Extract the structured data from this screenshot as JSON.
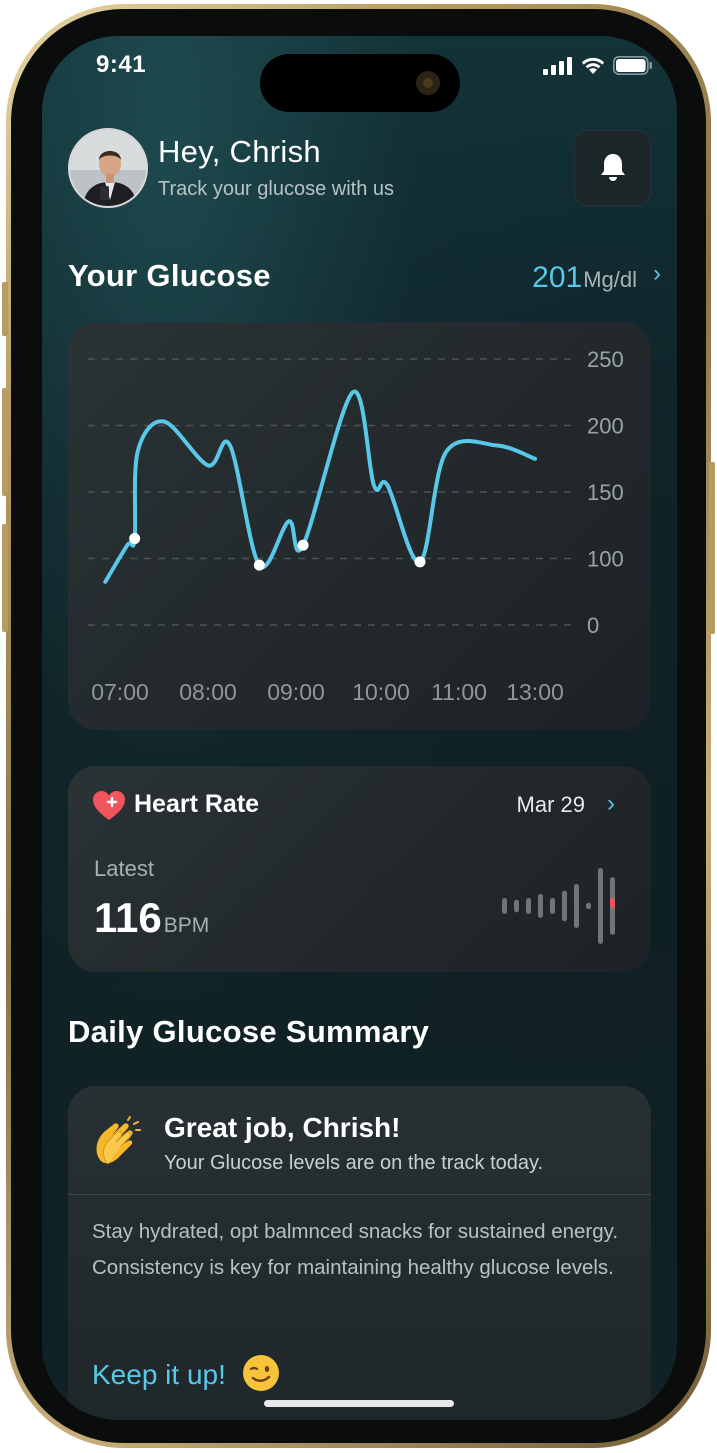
{
  "status_bar": {
    "time": "9:41"
  },
  "header": {
    "greeting": "Hey, Chrish",
    "subtitle": "Track your glucose with us",
    "bell_icon": "bell-icon"
  },
  "glucose": {
    "title": "Your Glucose",
    "value": "201",
    "unit": "Mg/dl",
    "chevron": "›"
  },
  "chart_data": {
    "type": "line",
    "title": "",
    "xlabel": "",
    "ylabel": "",
    "x_ticks": [
      "07:00",
      "08:00",
      "09:00",
      "10:00",
      "11:00",
      "13:00"
    ],
    "y_ticks": [
      "250",
      "200",
      "150",
      "100",
      "0"
    ],
    "series": [
      {
        "color": "#59c8e8",
        "points": [
          {
            "x": "06:50",
            "y": 65
          },
          {
            "x": "07:05",
            "y": 110
          },
          {
            "x": "07:10",
            "y": 115
          },
          {
            "x": "07:12",
            "y": 180
          },
          {
            "x": "07:30",
            "y": 203
          },
          {
            "x": "08:00",
            "y": 170
          },
          {
            "x": "08:15",
            "y": 185
          },
          {
            "x": "08:35",
            "y": 90
          },
          {
            "x": "08:55",
            "y": 128
          },
          {
            "x": "09:05",
            "y": 110
          },
          {
            "x": "09:40",
            "y": 225
          },
          {
            "x": "09:55",
            "y": 155
          },
          {
            "x": "10:05",
            "y": 155
          },
          {
            "x": "10:30",
            "y": 95
          },
          {
            "x": "10:50",
            "y": 180
          },
          {
            "x": "11:30",
            "y": 185
          },
          {
            "x": "12:00",
            "y": 175
          }
        ],
        "markers": [
          {
            "x": "07:10",
            "y": 115
          },
          {
            "x": "08:35",
            "y": 90
          },
          {
            "x": "09:05",
            "y": 110
          },
          {
            "x": "10:30",
            "y": 95
          }
        ]
      }
    ],
    "grid": "dashed-horizontal",
    "legend": "none"
  },
  "heart": {
    "title": "Heart Rate",
    "date": "Mar 29",
    "chevron": "›",
    "latest_label": "Latest",
    "value": "116",
    "unit": "BPM",
    "icon": "heart-icon",
    "bars": [
      {
        "value": 0.2,
        "color": "#6e7678"
      },
      {
        "value": 0.16,
        "color": "#6e7678"
      },
      {
        "value": 0.2,
        "color": "#6e7678"
      },
      {
        "value": 0.3,
        "color": "#6e7678"
      },
      {
        "value": 0.2,
        "color": "#6e7678"
      },
      {
        "value": 0.38,
        "color": "#6e7678"
      },
      {
        "value": 0.55,
        "color": "#6e7678"
      },
      {
        "value": 0.08,
        "color": "#6e7678"
      },
      {
        "value": 0.95,
        "color": "#6e7678"
      },
      {
        "value": 0.72,
        "color": "#6e7678"
      }
    ],
    "accent": "#f2545b"
  },
  "summary": {
    "title": "Daily Glucose Summary",
    "card_title": "Great job, Chrish!",
    "card_subtitle": "Your Glucose levels are on the track today.",
    "body": "Stay hydrated, opt balmnced snacks for sustained energy. Consistency is key for maintaining healthy glucose levels.",
    "cta": "Keep it up!",
    "clap_icon": "clapping-hands-icon",
    "wink_icon": "winking-face-icon"
  },
  "colors": {
    "accent": "#59c8e8",
    "heart": "#f2545b",
    "background": "#0f2328"
  }
}
